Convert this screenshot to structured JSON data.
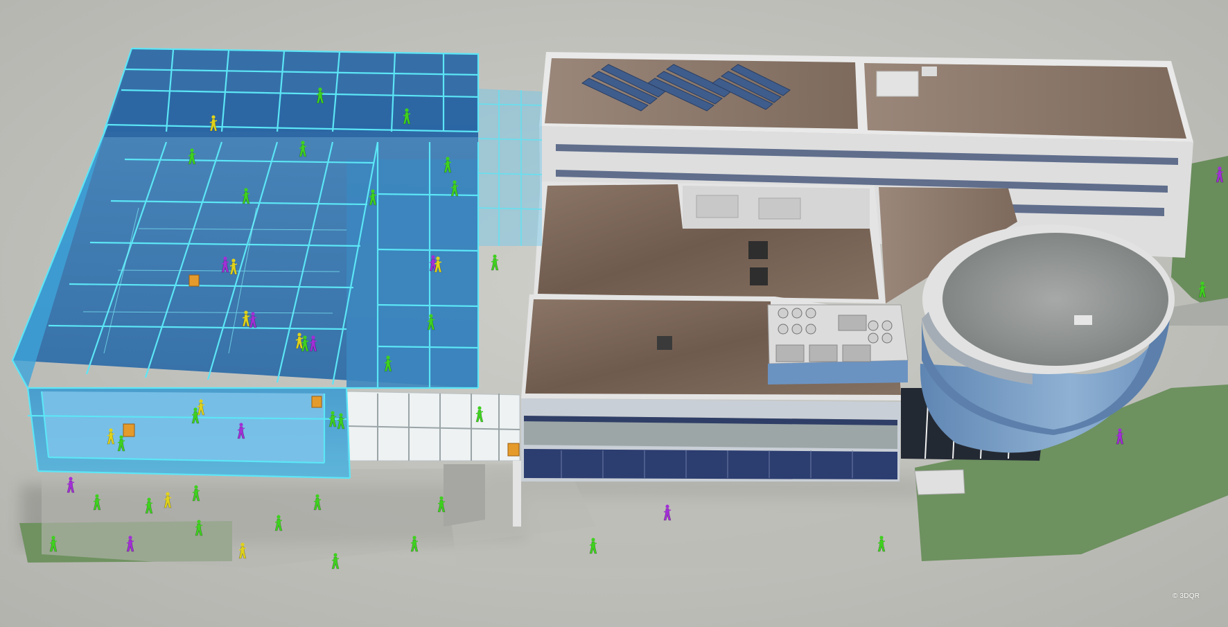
{
  "copyright": "© 3DQR",
  "colors": {
    "ground": "#c4c4bf",
    "lawn": "#6f9260",
    "wireframe": "#53e3f5",
    "roof": "#7a6657",
    "wall": "#dcdcdc",
    "glass": "#7fa4c9",
    "person_green": "#3fd11f",
    "person_purple": "#a22fd6",
    "person_yellow": "#e0d21a"
  },
  "scene": {
    "objects": [
      "ground-plane",
      "lawn-areas",
      "wireframe-building",
      "glass-bridge",
      "main-building",
      "rotunda",
      "hvac-units",
      "solar-panels",
      "people"
    ],
    "people_colors": [
      "green",
      "purple",
      "yellow"
    ],
    "icon": "crowd-figure-icon"
  }
}
